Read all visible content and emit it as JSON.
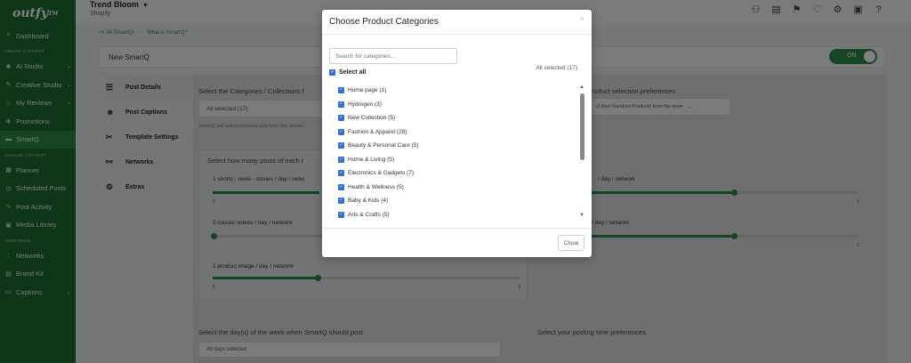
{
  "app": {
    "logo": "outfy",
    "logo_mark": "TM",
    "store_name": "Trend Bloom",
    "store_platform": "Shopify"
  },
  "sidebar": {
    "items": [
      {
        "label": "Dashboard",
        "icon": "grid-icon"
      },
      {
        "section": "CREATE CONTENT"
      },
      {
        "label": "AI Studio",
        "icon": "ai-studio-icon",
        "chevron": true
      },
      {
        "label": "Creative Studio",
        "icon": "brush-icon",
        "chevron": true
      },
      {
        "label": "My Reviews",
        "icon": "star-icon",
        "chevron": true
      },
      {
        "label": "Promotions",
        "icon": "tag-icon"
      },
      {
        "label": "SmartQ",
        "icon": "smartq-icon",
        "active": true
      },
      {
        "section": "MANAGE CONTENT"
      },
      {
        "label": "Planner",
        "icon": "calendar-icon"
      },
      {
        "label": "Scheduled Posts",
        "icon": "clock-icon"
      },
      {
        "label": "Post Activity",
        "icon": "activity-icon"
      },
      {
        "label": "Media Library",
        "icon": "media-icon"
      },
      {
        "section": "CONFIGURE"
      },
      {
        "label": "Networks",
        "icon": "network-icon"
      },
      {
        "label": "Brand Kit",
        "icon": "brand-kit-icon"
      },
      {
        "label": "Captions",
        "icon": "captions-icon",
        "chevron": true
      }
    ]
  },
  "breadcrumb": {
    "back": "<< All SmartQs",
    "separator": "/",
    "help": "What is SmartQ?"
  },
  "smartq": {
    "title": "New SmartQ",
    "toggle_label": "ON"
  },
  "tabs": [
    {
      "label": "Post Details",
      "icon": "sliders-icon",
      "active": true
    },
    {
      "label": "Post Captions",
      "icon": "caption-face-icon"
    },
    {
      "label": "Template Settings",
      "icon": "tools-icon"
    },
    {
      "label": "Networks",
      "icon": "share-icon"
    },
    {
      "label": "Extras",
      "icon": "extras-icon"
    }
  ],
  "post_details": {
    "categories_heading": "Select the Categories / Collections f",
    "categories_value": "All selected (17)",
    "categories_note": "SmartQ will select products only from the chosen",
    "preferences_heading": "roduct selection preferences",
    "preferences_value": "ct then Random Products from the store",
    "posts_heading": "Select how many posts of each t",
    "sliders": [
      {
        "label": "1 shorts - reels - stories / day / netw",
        "min": "0",
        "max": "",
        "value_fraction": 1.0
      },
      {
        "label": "0 classic videos / day / network",
        "min": "",
        "max": "",
        "value_fraction": 0.0
      },
      {
        "label": "1 product image / day / network",
        "min": "0",
        "max": "3",
        "value_fraction": 0.33
      }
    ],
    "right_sliders": [
      {
        "label": "/ day / network",
        "max": "1",
        "value_fraction": 0.55
      },
      {
        "label": "/ day / network",
        "max": "1",
        "value_fraction": 0.55
      }
    ],
    "days_heading": "Select the day(s) of the week when SmartQ should post",
    "days_value": "All days selected",
    "time_heading": "Select your posting time preferences"
  },
  "modal": {
    "title": "Choose Product Categories",
    "close_icon": "×",
    "search_placeholder": "Search for categories...",
    "select_all_label": "Select all",
    "all_selected_label": "All selected (17)",
    "categories": [
      "Home page (1)",
      "Hydrogen (3)",
      "New Collection (5)",
      "Fashion & Apparel (28)",
      "Beauty & Personal Care (5)",
      "Home & Living (5)",
      "Electronics & Gadgets (7)",
      "Health & Wellness (5)",
      "Baby & Kids (4)",
      "Arts & Crafts (5)"
    ],
    "close_button": "Close"
  },
  "colors": {
    "brand_green": "#1e6b33",
    "accent_green": "#2b8a45",
    "checkbox_blue": "#2e6fd8"
  }
}
